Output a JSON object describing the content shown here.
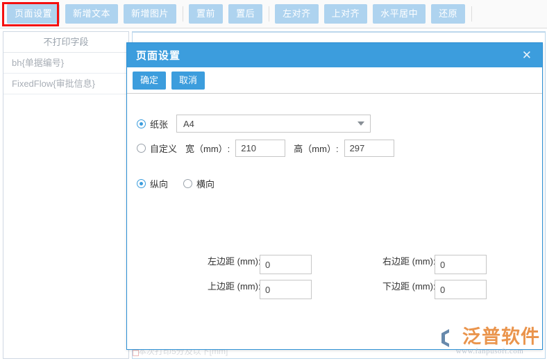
{
  "toolbar": {
    "buttons": [
      {
        "label": "页面设置",
        "name": "page-setup"
      },
      {
        "label": "新增文本",
        "name": "add-text"
      },
      {
        "label": "新增图片",
        "name": "add-image"
      },
      {
        "label": "置前",
        "name": "bring-front"
      },
      {
        "label": "置后",
        "name": "send-back"
      },
      {
        "label": "左对齐",
        "name": "align-left"
      },
      {
        "label": "上对齐",
        "name": "align-top"
      },
      {
        "label": "水平居中",
        "name": "align-center-horizontal"
      },
      {
        "label": "还原",
        "name": "restore"
      }
    ],
    "highlight_color": "#f40f0f",
    "button_color": "#aed3ef"
  },
  "left_panel": {
    "header": "不打印字段",
    "items": [
      {
        "label": "bh{单据编号}"
      },
      {
        "label": "FixedFlow{审批信息}"
      }
    ]
  },
  "canvas": {
    "hidden_text": "本次打印5分及以下[mm]"
  },
  "dialog": {
    "title": "页面设置",
    "close_icon": "close-icon",
    "confirm_label": "确定",
    "cancel_label": "取消",
    "paper": {
      "radio_label": "纸张",
      "selected": true,
      "value": "A4",
      "dropdown_icon": "chevron-down-icon"
    },
    "custom": {
      "radio_label": "自定义",
      "selected": false,
      "width_label": "宽（mm）:",
      "width_value": "210",
      "height_label": "高（mm）:",
      "height_value": "297"
    },
    "orientation": {
      "portrait_label": "纵向",
      "portrait_selected": true,
      "landscape_label": "横向",
      "landscape_selected": false
    },
    "margins": {
      "left_label": "左边距 (mm):",
      "left_value": "0",
      "right_label": "右边距 (mm):",
      "right_value": "0",
      "top_label": "上边距 (mm):",
      "top_value": "0",
      "bottom_label": "下边距 (mm):",
      "bottom_value": "0"
    },
    "header_color": "#3c9ddd"
  },
  "watermark": {
    "text": "泛普软件",
    "url": "www.fanpusoft.com"
  }
}
